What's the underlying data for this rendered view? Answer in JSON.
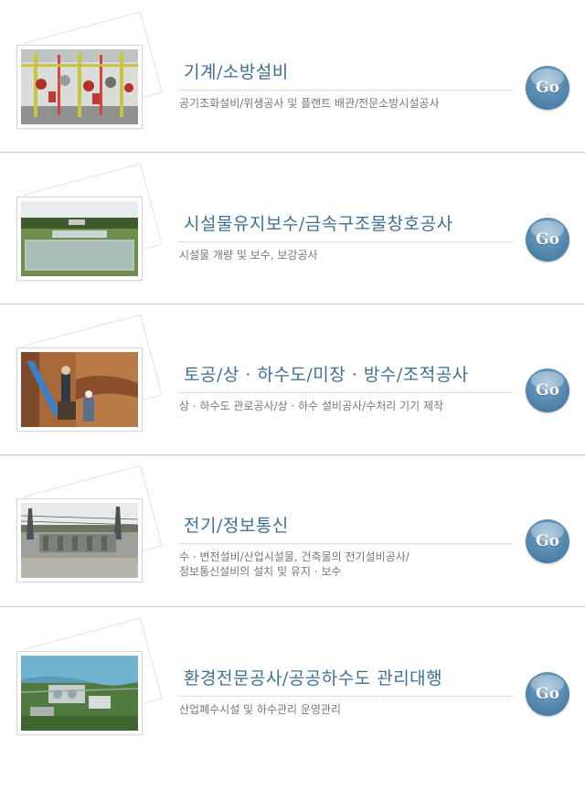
{
  "items": [
    {
      "title": "기계/소방설비",
      "desc_lines": [
        "공기조화설비/위생공사 및 플랜트 배관/전문소방시설공사"
      ],
      "image": "machinery-piping-photo",
      "button": "Go"
    },
    {
      "title": "시설물유지보수/금속구조물창호공사",
      "desc_lines": [
        "시설물 개량 및 보수, 보강공사"
      ],
      "image": "water-treatment-basin-photo",
      "button": "Go"
    },
    {
      "title": "토공/상 · 하수도/미장 · 방수/조적공사",
      "desc_lines": [
        "상 · 하수도 관로공사/상 · 하수 설비공사/수처리 기기 제작"
      ],
      "image": "pipe-trench-construction-photo",
      "button": "Go"
    },
    {
      "title": "전기/정보통신",
      "desc_lines": [
        "수 · 변전설비/산업시설물, 건축물의 전기설비공사/",
        "정보통신설비의 설치 및 유지 · 보수"
      ],
      "image": "electrical-substation-photo",
      "button": "Go"
    },
    {
      "title": "환경전문공사/공공하수도 관리대행",
      "desc_lines": [
        "산업폐수시설 및 하수관리 운영관리"
      ],
      "image": "sewage-plant-aerial-photo",
      "button": "Go"
    }
  ]
}
